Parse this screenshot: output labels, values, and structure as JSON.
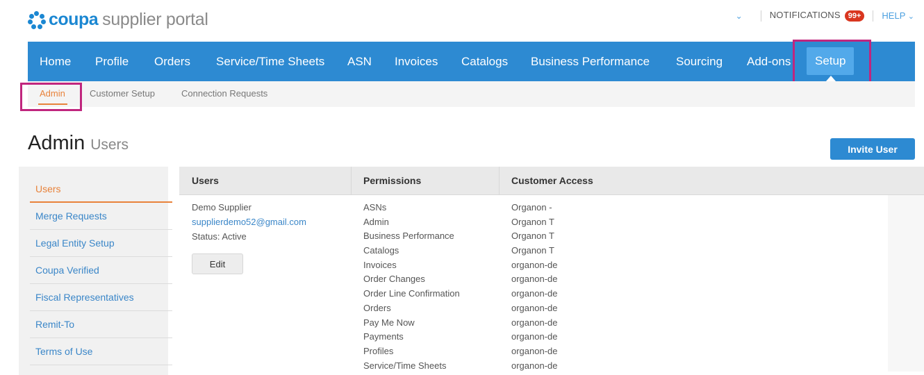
{
  "header": {
    "logo_brand": "coupa",
    "logo_suffix": "supplier portal",
    "notifications_label": "NOTIFICATIONS",
    "notifications_count": "99+",
    "help_label": "HELP",
    "dropdown_chevron": "chevron-down-icon"
  },
  "nav": {
    "items": [
      {
        "label": "Home"
      },
      {
        "label": "Profile"
      },
      {
        "label": "Orders"
      },
      {
        "label": "Service/Time Sheets"
      },
      {
        "label": "ASN"
      },
      {
        "label": "Invoices"
      },
      {
        "label": "Catalogs"
      },
      {
        "label": "Business Performance"
      },
      {
        "label": "Sourcing"
      },
      {
        "label": "Add-ons"
      },
      {
        "label": "Setup"
      }
    ],
    "active": "Setup"
  },
  "subnav": {
    "items": [
      {
        "label": "Admin"
      },
      {
        "label": "Customer Setup"
      },
      {
        "label": "Connection Requests"
      }
    ],
    "active": "Admin"
  },
  "page": {
    "title": "Admin",
    "subtitle": "Users",
    "invite_button": "Invite User"
  },
  "sidebar": {
    "items": [
      {
        "label": "Users"
      },
      {
        "label": "Merge Requests"
      },
      {
        "label": "Legal Entity Setup"
      },
      {
        "label": "Coupa Verified"
      },
      {
        "label": "Fiscal Representatives"
      },
      {
        "label": "Remit-To"
      },
      {
        "label": "Terms of Use"
      }
    ],
    "active": "Users"
  },
  "table": {
    "headers": [
      "Users",
      "Permissions",
      "Customer Access"
    ],
    "row": {
      "name": "Demo Supplier",
      "email": "supplierdemo52@gmail.com",
      "status": "Status: Active",
      "edit_label": "Edit",
      "permissions": [
        "ASNs",
        "Admin",
        "Business Performance",
        "Catalogs",
        "Invoices",
        "Order Changes",
        "Order Line Confirmation",
        "Orders",
        "Pay Me Now",
        "Payments",
        "Profiles",
        "Service/Time Sheets"
      ],
      "customer_access": [
        "Organon -",
        "Organon T",
        "Organon T",
        "Organon T",
        "organon-de",
        "organon-de",
        "organon-de",
        "organon-de",
        "organon-de",
        "organon-de",
        "organon-de",
        "organon-de"
      ]
    }
  },
  "colors": {
    "brand": "#1b87d2",
    "nav_bg": "#2d8ad2",
    "nav_active": "#52a9ea",
    "accent_orange": "#e8823a",
    "link": "#3a86c8",
    "highlight_box": "#c0267e",
    "badge": "#d9361f"
  }
}
